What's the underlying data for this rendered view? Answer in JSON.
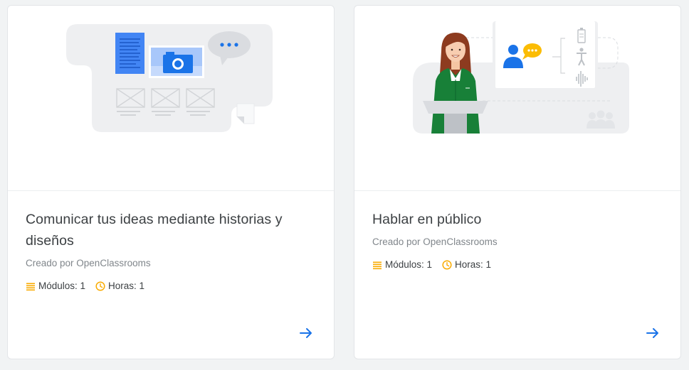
{
  "colors": {
    "accent_blue": "#1a73e8",
    "meta_yellow": "#f9ab00",
    "text_primary": "#3c4043",
    "text_secondary": "#80868b"
  },
  "courses": [
    {
      "title": "Comunicar tus ideas mediante historias y diseños",
      "creator": "Creado por OpenClassrooms",
      "modules_label": "Módulos: 1",
      "hours_label": "Horas: 1",
      "illustration": "documents-camera-chat-illustration",
      "action_icon": "arrow-right-icon"
    },
    {
      "title": "Hablar en público",
      "creator": "Creado por OpenClassrooms",
      "modules_label": "Módulos: 1",
      "hours_label": "Horas: 1",
      "illustration": "speaker-at-podium-illustration",
      "action_icon": "arrow-right-icon"
    }
  ]
}
